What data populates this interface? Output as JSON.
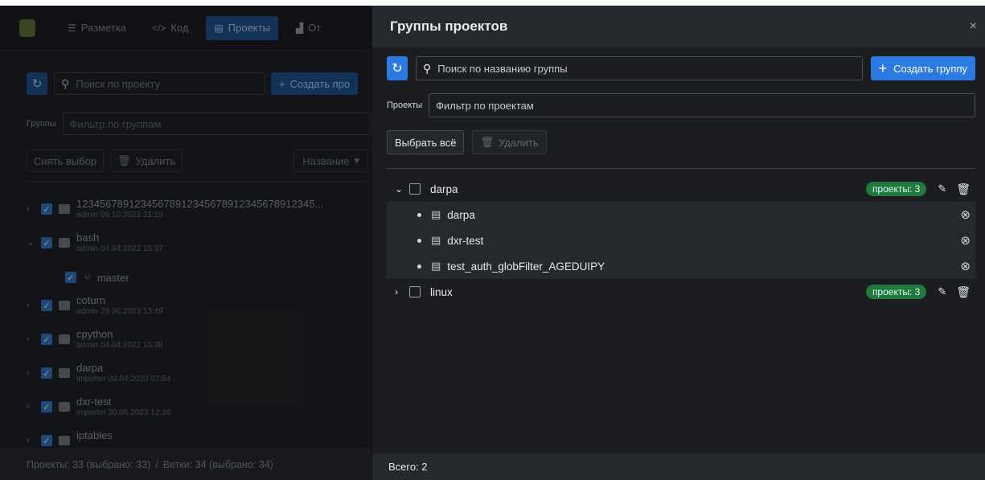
{
  "app": {
    "tabs": [
      {
        "icon": "markup-icon",
        "label": "Разметка"
      },
      {
        "icon": "code-icon",
        "label": "Код"
      },
      {
        "icon": "archive-icon",
        "label": "Проекты"
      },
      {
        "icon": "chart-icon",
        "label": "От"
      }
    ],
    "search_placeholder": "Поиск по проекту",
    "create_label": "Создать про",
    "groups_label": "Группы",
    "groups_filter_placeholder": "Фильтр по группам",
    "deselect_label": "Снять выбор",
    "delete_label": "Удалить",
    "sort_label": "Название",
    "projects": [
      {
        "name": "12345678912345678912345678912345678912345...",
        "meta": "admin 09.10.2023 21:19"
      },
      {
        "name": "bash",
        "meta": "admin 04.04.2022 15:37"
      },
      {
        "name": "coturn",
        "meta": "admin 29.06.2023 13:49"
      },
      {
        "name": "cpython",
        "meta": "admin 04.04.2022 15:38"
      },
      {
        "name": "darpa",
        "meta": "importer 03.04.2020 07:54"
      },
      {
        "name": "dxr-test",
        "meta": "importer 30.06.2023 12:38"
      },
      {
        "name": "iptables",
        "meta": ""
      }
    ],
    "branch": {
      "name": "master"
    },
    "footer": {
      "projects": "Проекты: 33 (выбрано: 33)",
      "sep": "/",
      "branches": "Ветки: 34 (выбрано: 34)"
    }
  },
  "dialog": {
    "title": "Группы проектов",
    "close": "×",
    "search_placeholder": "Поиск по названию группы",
    "create_group_label": "Создать группу",
    "projects_label": "Проекты",
    "projects_filter_placeholder": "Фильтр по проектам",
    "select_all_label": "Выбрать всё",
    "delete_label": "Удалить",
    "groups": [
      {
        "name": "darpa",
        "badge": "проекты: 3",
        "expanded": true,
        "projects": [
          "darpa",
          "dxr-test",
          "test_auth_globFilter_AGEDUIPY"
        ]
      },
      {
        "name": "linux",
        "badge": "проекты: 3",
        "expanded": false,
        "projects": []
      }
    ],
    "footer": "Всего: 2"
  }
}
